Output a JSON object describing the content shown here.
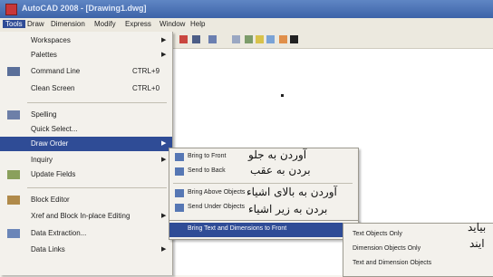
{
  "window": {
    "title": "AutoCAD 2008 - [Drawing1.dwg]"
  },
  "menubar": [
    "Tools",
    "Draw",
    "Dimension",
    "Modify",
    "Express",
    "Window",
    "Help"
  ],
  "tools_menu": {
    "items": [
      {
        "label": "Workspaces",
        "shortcut": "",
        "submenu": true
      },
      {
        "label": "Palettes",
        "shortcut": "",
        "submenu": true
      },
      {
        "label": "Command Line",
        "shortcut": "CTRL+9",
        "submenu": false
      },
      {
        "label": "Clean Screen",
        "shortcut": "CTRL+0",
        "submenu": false
      },
      {
        "label": "Spelling",
        "shortcut": "",
        "submenu": false
      },
      {
        "label": "Quick Select...",
        "shortcut": "",
        "submenu": false
      },
      {
        "label": "Draw Order",
        "shortcut": "",
        "submenu": true
      },
      {
        "label": "Inquiry",
        "shortcut": "",
        "submenu": true
      },
      {
        "label": "Update Fields",
        "shortcut": "",
        "submenu": false
      },
      {
        "label": "Block Editor",
        "shortcut": "",
        "submenu": false
      },
      {
        "label": "Xref and Block In-place Editing",
        "shortcut": "",
        "submenu": true
      },
      {
        "label": "Data Extraction...",
        "shortcut": "",
        "submenu": false
      },
      {
        "label": "Data Links",
        "shortcut": "",
        "submenu": true
      }
    ]
  },
  "draw_order_menu": {
    "items": [
      {
        "label": "Bring to Front"
      },
      {
        "label": "Send to Back"
      },
      {
        "label": "Bring Above Objects"
      },
      {
        "label": "Send Under Objects"
      },
      {
        "label": "Bring Text and Dimensions to Front"
      }
    ]
  },
  "text_dim_menu": {
    "items": [
      {
        "label": "Text Objects Only"
      },
      {
        "label": "Dimension Objects Only"
      },
      {
        "label": "Text and Dimension Objects"
      }
    ]
  },
  "annotations": {
    "bring_to_front": "آوردن به جلو",
    "send_to_back": "بردن به عقب",
    "bring_above": "آوردن به بالای اشیاء",
    "send_under": "بردن به زیر اشیاء",
    "partial_1": "بیاید",
    "partial_2": "ایند"
  }
}
